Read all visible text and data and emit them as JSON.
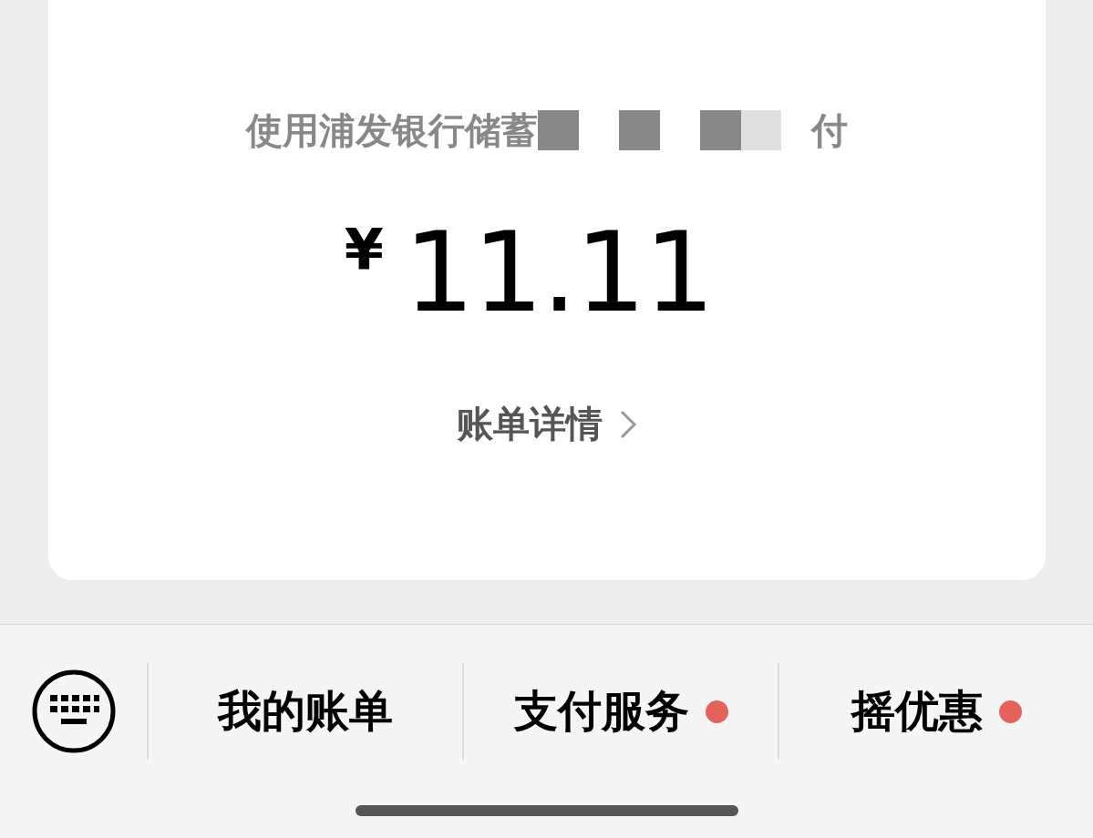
{
  "payment_card": {
    "title_start": "使用浦发银行储蓄",
    "title_end": "付",
    "amount_currency": "¥",
    "amount": "11.11",
    "details_link": "账单详情"
  },
  "bottom_bar": {
    "items": [
      {
        "label": "我的账单",
        "dot": false
      },
      {
        "label": "支付服务",
        "dot": true
      },
      {
        "label": "摇优惠",
        "dot": true
      }
    ]
  }
}
